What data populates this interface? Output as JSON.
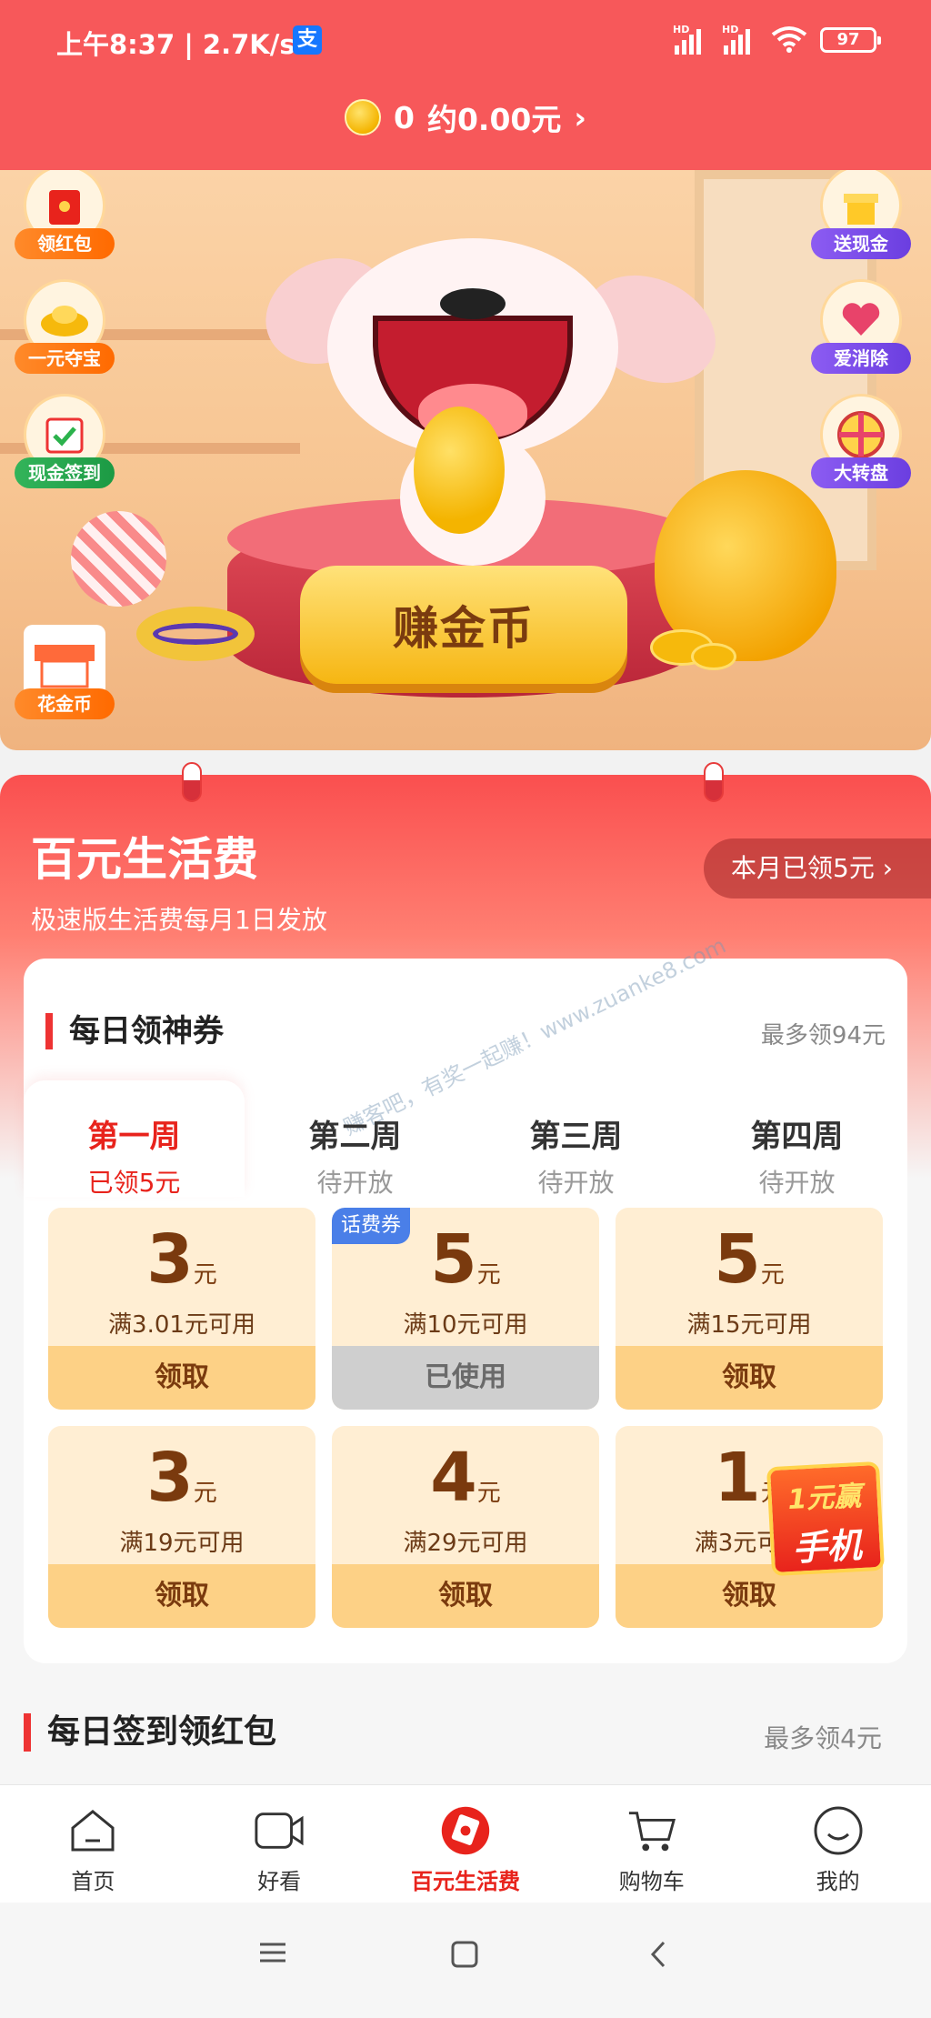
{
  "status": {
    "time": "上午8:37 | 2.7K/s",
    "pay_icon_text": "支",
    "hd1": "HD",
    "hd2": "HD",
    "battery": "97"
  },
  "header": {
    "coins": "0",
    "money": "约0.00元",
    "chevron": "›"
  },
  "hero": {
    "earn_button": "赚金币",
    "left_buttons": [
      {
        "label": "领红包",
        "icon": "red-envelope-icon"
      },
      {
        "label": "一元夺宝",
        "icon": "gold-ingot-icon"
      },
      {
        "label": "现金签到",
        "icon": "calendar-check-icon"
      },
      {
        "label": "花金币",
        "icon": "shop-icon"
      }
    ],
    "right_buttons": [
      {
        "label": "送现金",
        "icon": "gift-cash-icon"
      },
      {
        "label": "爱消除",
        "icon": "heart-box-icon"
      },
      {
        "label": "大转盘",
        "icon": "wheel-icon"
      }
    ]
  },
  "section": {
    "title": "百元生活费",
    "subtitle": "极速版生活费每月1日发放",
    "month_pill": "本月已领5元 ›"
  },
  "panel": {
    "title": "每日领神券",
    "right": "最多领94元",
    "watermark": "赚客吧，有奖一起赚！www.zuanke8.com"
  },
  "weeks": [
    {
      "name": "第一周",
      "status": "已领5元"
    },
    {
      "name": "第二周",
      "status": "待开放"
    },
    {
      "name": "第三周",
      "status": "待开放"
    },
    {
      "name": "第四周",
      "status": "待开放"
    }
  ],
  "coupons": [
    {
      "amount": "3",
      "unit": "元",
      "condition": "满3.01元可用",
      "action": "领取",
      "badge": ""
    },
    {
      "amount": "5",
      "unit": "元",
      "condition": "满10元可用",
      "action": "已使用",
      "badge": "话费券"
    },
    {
      "amount": "5",
      "unit": "元",
      "condition": "满15元可用",
      "action": "领取",
      "badge": ""
    },
    {
      "amount": "3",
      "unit": "元",
      "condition": "满19元可用",
      "action": "领取",
      "badge": ""
    },
    {
      "amount": "4",
      "unit": "元",
      "condition": "满29元可用",
      "action": "领取",
      "badge": ""
    },
    {
      "amount": "1",
      "unit": "元",
      "condition": "满3元可用",
      "action": "领取",
      "badge": ""
    }
  ],
  "promo": {
    "line1": "1元赢",
    "line2": "手机"
  },
  "daily": {
    "title": "每日签到领红包",
    "right": "最多领4元"
  },
  "tabbar": [
    {
      "label": "首页",
      "icon": "home-icon"
    },
    {
      "label": "好看",
      "icon": "video-icon"
    },
    {
      "label": "百元生活费",
      "icon": "red-envelope-tab-icon"
    },
    {
      "label": "购物车",
      "icon": "cart-icon"
    },
    {
      "label": "我的",
      "icon": "profile-icon"
    }
  ],
  "colors": {
    "brand_red": "#f7585a",
    "active_red": "#e8231c",
    "coupon_bg": "#ffeed3"
  }
}
